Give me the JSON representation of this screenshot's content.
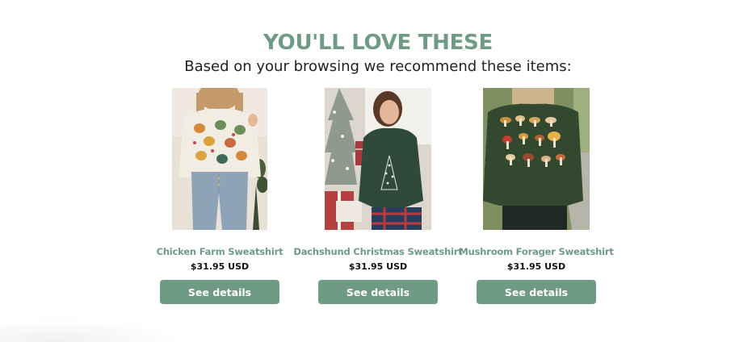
{
  "section": {
    "heading": "YOU'LL LOVE THESE",
    "subheading": "Based on your browsing we recommend these items:"
  },
  "products": [
    {
      "name": "Chicken Farm Sweatshirt",
      "price": "$31.95 USD",
      "button_label": "See details",
      "image_alt": "Model wearing cream sweatshirt with colorful chicken pattern"
    },
    {
      "name": "Dachshund Christmas Sweatshirt",
      "price": "$31.95 USD",
      "button_label": "See details",
      "image_alt": "Model wearing dark green sweatshirt with dachshund Christmas tree design"
    },
    {
      "name": "Mushroom Forager Sweatshirt",
      "price": "$31.95 USD",
      "button_label": "See details",
      "image_alt": "Model wearing dark green sweatshirt with mushroom illustrations"
    }
  ],
  "colors": {
    "accent": "#6f9b85",
    "text": "#222222",
    "price": "#111111",
    "background": "#ffffff"
  }
}
